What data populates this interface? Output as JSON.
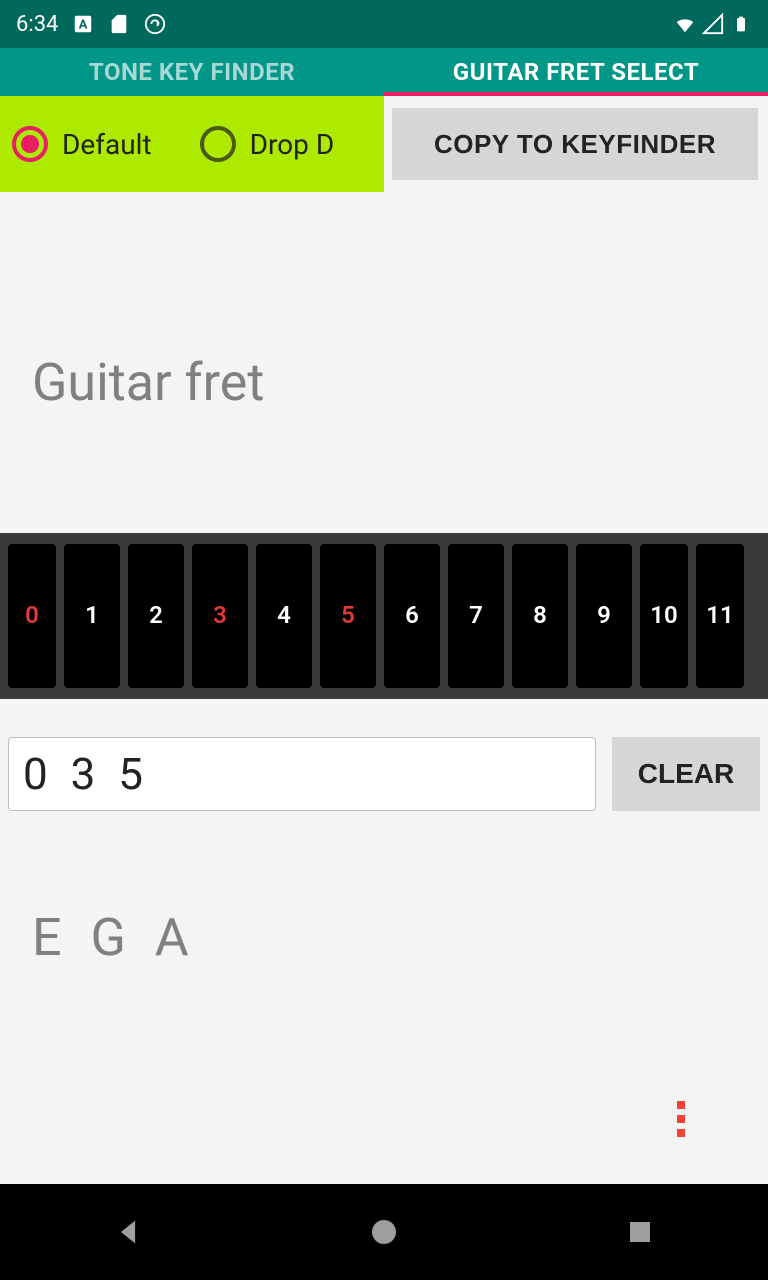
{
  "status": {
    "time": "6:34"
  },
  "tabs": [
    {
      "label": "TONE KEY FINDER",
      "active": false
    },
    {
      "label": "GUITAR FRET SELECT",
      "active": true
    }
  ],
  "tuning": {
    "options": [
      {
        "label": "Default",
        "selected": true
      },
      {
        "label": "Drop D",
        "selected": false
      }
    ]
  },
  "copy_button": "COPY TO KEYFINDER",
  "section_title": "Guitar fret",
  "frets": [
    {
      "n": "0",
      "selected": true
    },
    {
      "n": "1",
      "selected": false
    },
    {
      "n": "2",
      "selected": false
    },
    {
      "n": "3",
      "selected": true
    },
    {
      "n": "4",
      "selected": false
    },
    {
      "n": "5",
      "selected": true
    },
    {
      "n": "6",
      "selected": false
    },
    {
      "n": "7",
      "selected": false
    },
    {
      "n": "8",
      "selected": false
    },
    {
      "n": "9",
      "selected": false
    },
    {
      "n": "10",
      "selected": false
    },
    {
      "n": "11",
      "selected": false
    }
  ],
  "fret_input": "0 3 5",
  "clear_button": "CLEAR",
  "notes": "E G A"
}
